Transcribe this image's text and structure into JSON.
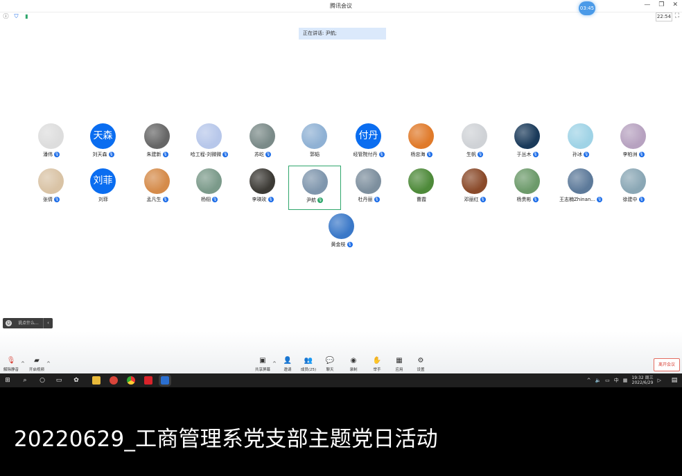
{
  "window": {
    "title": "腾讯会议",
    "timer": "03:45",
    "clock": "22:54"
  },
  "speaking_banner": "正在讲话: 尹航;",
  "participants": [
    {
      "name": "潘伟",
      "avatar_text": "",
      "color": "#ddd",
      "mic": true
    },
    {
      "name": "刘天森",
      "avatar_text": "天森",
      "color": "#0a6df0",
      "mic": true
    },
    {
      "name": "朱建新",
      "avatar_text": "",
      "color": "#666",
      "mic": true
    },
    {
      "name": "哈工程-刘微微",
      "avatar_text": "",
      "color": "#b7c7ea",
      "mic": true
    },
    {
      "name": "苏屹",
      "avatar_text": "",
      "color": "#7a8a88",
      "mic": true
    },
    {
      "name": "郭韬",
      "avatar_text": "",
      "color": "#8fb1d4",
      "mic": false
    },
    {
      "name": "经管院付丹",
      "avatar_text": "付丹",
      "color": "#0a6df0",
      "mic": true
    },
    {
      "name": "杨忠海",
      "avatar_text": "",
      "color": "#e07a2a",
      "mic": true
    },
    {
      "name": "生帆",
      "avatar_text": "",
      "color": "#cfd2d6",
      "mic": true
    },
    {
      "name": "于丛木",
      "avatar_text": "",
      "color": "#1a3a5a",
      "mic": true
    },
    {
      "name": "孙冰",
      "avatar_text": "",
      "color": "#9fd3e6",
      "mic": true
    },
    {
      "name": "李柏洲",
      "avatar_text": "",
      "color": "#b7a2c0",
      "mic": true
    },
    {
      "name": "张倩",
      "avatar_text": "",
      "color": "#d9c3a5",
      "mic": true
    },
    {
      "name": "刘菲",
      "avatar_text": "刘菲",
      "color": "#0a6df0",
      "mic": false
    },
    {
      "name": "孟凡生",
      "avatar_text": "",
      "color": "#d58b4a",
      "mic": true
    },
    {
      "name": "杨栩",
      "avatar_text": "",
      "color": "#7b9a8a",
      "mic": true
    },
    {
      "name": "李瑛玫",
      "avatar_text": "",
      "color": "#3c3a35",
      "mic": true
    },
    {
      "name": "尹航",
      "avatar_text": "",
      "color": "#7f96ad",
      "mic": true,
      "speaking": true
    },
    {
      "name": "杜丹丽",
      "avatar_text": "",
      "color": "#7d8f9e",
      "mic": true
    },
    {
      "name": "曹霞",
      "avatar_text": "",
      "color": "#4e8a3a",
      "mic": false
    },
    {
      "name": "邓丽红",
      "avatar_text": "",
      "color": "#8a4a2a",
      "mic": true
    },
    {
      "name": "杨贵彬",
      "avatar_text": "",
      "color": "#6c9a6a",
      "mic": true
    },
    {
      "name": "王志楠Zhinan...",
      "avatar_text": "",
      "color": "#5d7a9a",
      "mic": true
    },
    {
      "name": "徐建中",
      "avatar_text": "",
      "color": "#8aa7b5",
      "mic": true
    },
    {
      "name": "黄金枝",
      "avatar_text": "",
      "color": "#3a78c8",
      "mic": true
    }
  ],
  "chat_hint": "说点什么...",
  "toolbar": {
    "unmute": "解除静音",
    "start_video": "开启视频",
    "share_screen": "共享屏幕",
    "invite": "邀请",
    "members": "成员(25)",
    "chat": "聊天",
    "record": "录制",
    "raise_hand": "举手",
    "apps": "应用",
    "settings": "设置",
    "leave": "离开会议"
  },
  "taskbar": {
    "time": "19:32 周三",
    "date": "2022/6/29",
    "ime": "中"
  },
  "subtitle": "20220629_工商管理系党支部主题党日活动"
}
